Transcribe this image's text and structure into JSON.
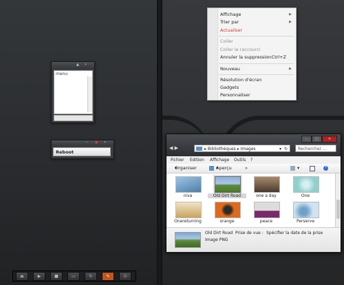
{
  "context_menu": {
    "items": [
      {
        "label": "Affichage",
        "submenu": true,
        "state": "normal"
      },
      {
        "label": "Trier par",
        "submenu": true,
        "state": "normal"
      },
      {
        "label": "Actualiser",
        "state": "highlight"
      },
      {
        "label": "Coller",
        "state": "disabled"
      },
      {
        "label": "Coller le raccourci",
        "state": "disabled"
      },
      {
        "label": "Annuler la suppression",
        "shortcut": "Ctrl+Z",
        "state": "normal"
      },
      {
        "label": "Nouveau",
        "submenu": true,
        "state": "normal"
      },
      {
        "label": "Résolution d'écran",
        "state": "normal"
      },
      {
        "label": "Gadgets",
        "state": "normal"
      },
      {
        "label": "Personnaliser",
        "state": "normal"
      }
    ],
    "colors": {
      "highlight": "#d23a2a",
      "disabled": "#8f8f8f"
    }
  },
  "menu_widget": {
    "label": "menu"
  },
  "reboot_widget": {
    "button_label": "Reboot"
  },
  "explorer": {
    "breadcrumb": [
      "Bibliothèques",
      "Images"
    ],
    "search_placeholder": "Rechercher ...",
    "menubar": [
      "Fichier",
      "Edition",
      "Affichage",
      "Outils",
      "?"
    ],
    "toolbar": {
      "organize": "Organiser",
      "preview": "Aperçu"
    },
    "files": [
      {
        "name": "niva",
        "selected": false,
        "palette": [
          "#9ec4e6",
          "#4d7fa6"
        ]
      },
      {
        "name": "Old Dirt Road",
        "selected": true,
        "palette": [
          "#8db2dd",
          "#4b7a2c"
        ]
      },
      {
        "name": "one a day",
        "selected": false,
        "palette": [
          "#a98a6a",
          "#4a3a2e"
        ]
      },
      {
        "name": "One",
        "selected": false,
        "palette": [
          "#8fd0cf",
          "#d8eef0"
        ]
      },
      {
        "name": "Onereturning",
        "selected": false,
        "palette": [
          "#f1e3c4",
          "#c9a45e"
        ]
      },
      {
        "name": "orange",
        "selected": false,
        "palette": [
          "#e06a1a",
          "#2b2b2b"
        ]
      },
      {
        "name": "peace",
        "selected": false,
        "palette": [
          "#7a2a6a",
          "#dcdcdc"
        ]
      },
      {
        "name": "Perserve",
        "selected": false,
        "palette": [
          "#cfe3f1",
          "#6fa0c8"
        ]
      }
    ],
    "details": {
      "name": "Old Dirt Road",
      "field_label": "Prise de vue :",
      "field_value": "Spécifier la date de la prise",
      "type": "Image PNG"
    }
  },
  "taskbar": {
    "buttons": [
      {
        "icon": "eject-icon",
        "glyph": "⏏",
        "active": false
      },
      {
        "icon": "play-icon",
        "glyph": "▶",
        "active": false
      },
      {
        "icon": "camera-icon",
        "glyph": "■",
        "active": false
      },
      {
        "icon": "monitor-icon",
        "glyph": "▭",
        "active": false
      },
      {
        "icon": "refresh-icon",
        "glyph": "↻",
        "active": false
      },
      {
        "icon": "tools-icon",
        "glyph": "✎",
        "active": true
      },
      {
        "icon": "power-icon",
        "glyph": "⏻",
        "active": false
      }
    ]
  }
}
